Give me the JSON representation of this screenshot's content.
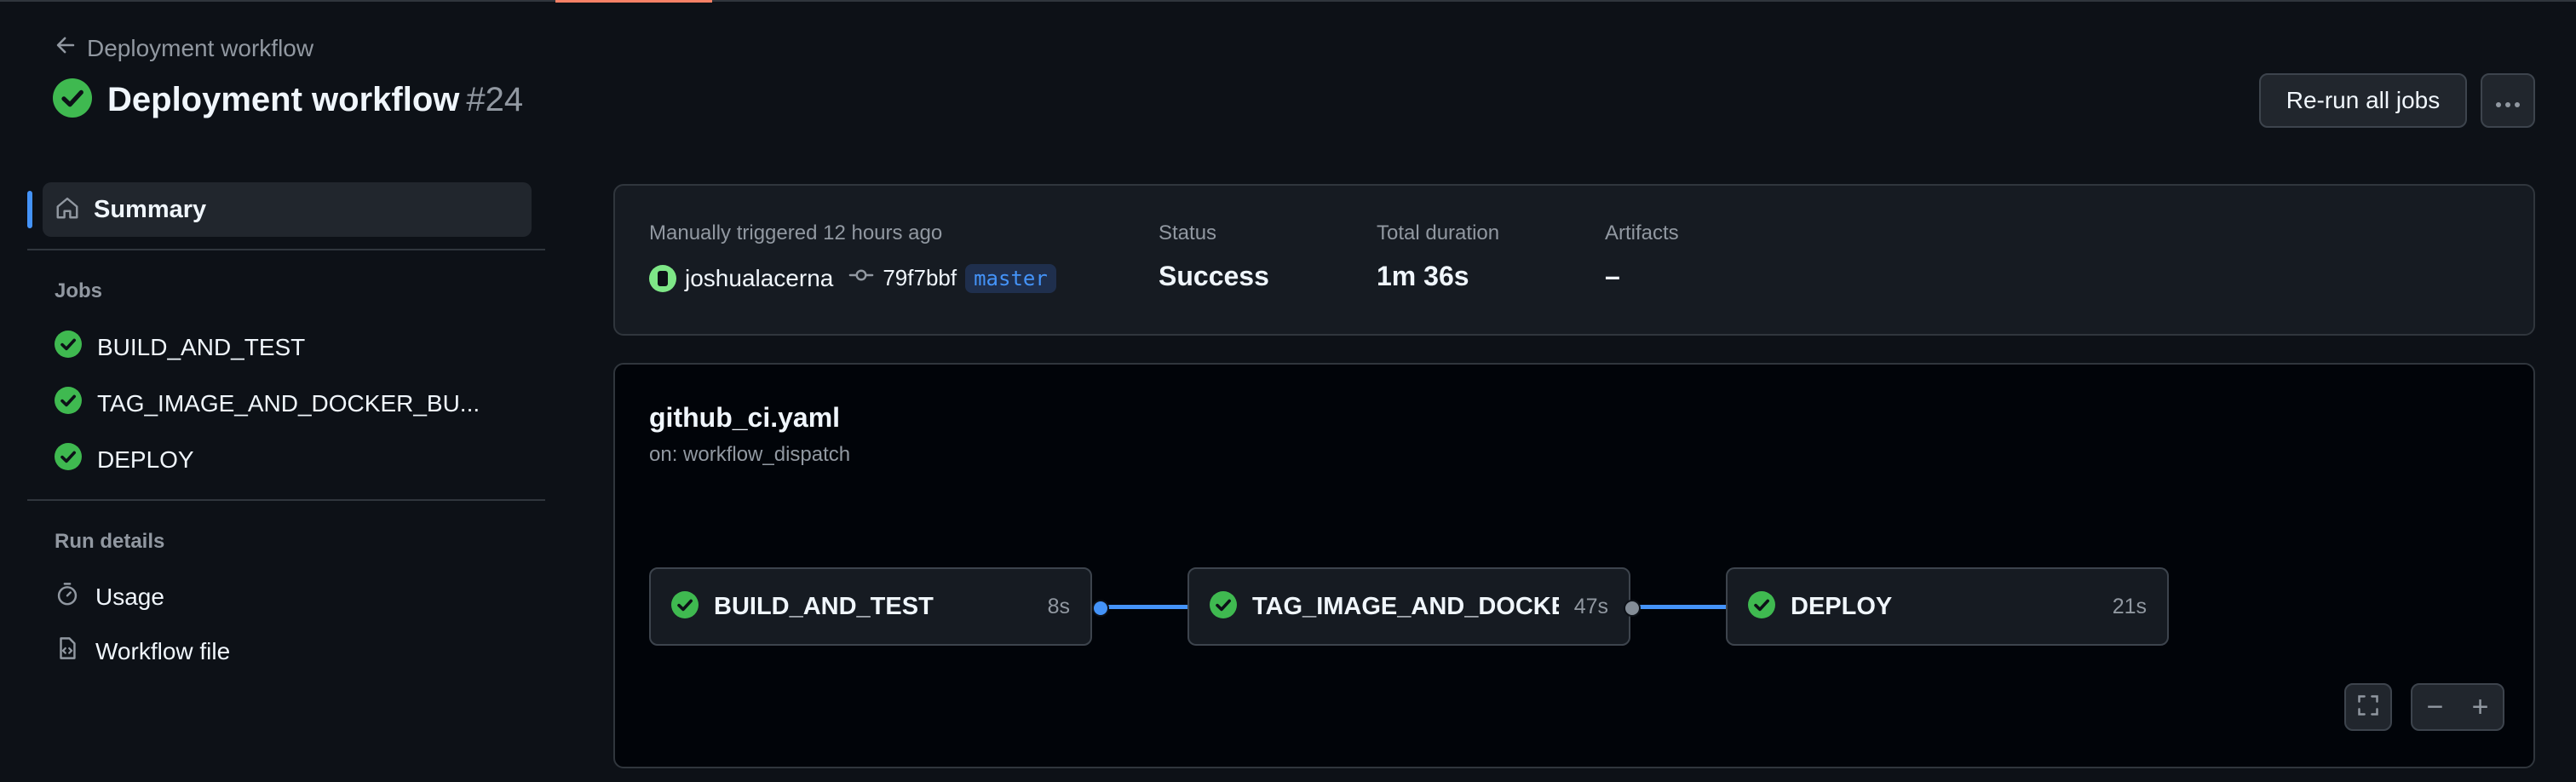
{
  "header": {
    "back_label": "Deployment workflow",
    "title": "Deployment workflow",
    "run_number": "#24",
    "rerun_label": "Re-run all jobs",
    "more_label": "···"
  },
  "sidebar": {
    "summary_label": "Summary",
    "jobs_heading": "Jobs",
    "jobs": [
      {
        "label": "BUILD_AND_TEST",
        "status": "success"
      },
      {
        "label": "TAG_IMAGE_AND_DOCKER_BU...",
        "status": "success"
      },
      {
        "label": "DEPLOY",
        "status": "success"
      }
    ],
    "run_details_heading": "Run details",
    "usage_label": "Usage",
    "workflow_file_label": "Workflow file"
  },
  "summary": {
    "trigger_text": "Manually triggered 12 hours ago",
    "actor": "joshualacerna",
    "commit": "79f7bbf",
    "branch": "master",
    "status_label": "Status",
    "status_value": "Success",
    "duration_label": "Total duration",
    "duration_value": "1m 36s",
    "artifacts_label": "Artifacts",
    "artifacts_value": "–"
  },
  "graph": {
    "file_name": "github_ci.yaml",
    "trigger": "on: workflow_dispatch",
    "jobs": [
      {
        "label": "BUILD_AND_TEST",
        "duration": "8s"
      },
      {
        "label": "TAG_IMAGE_AND_DOCKE...",
        "duration": "47s"
      },
      {
        "label": "DEPLOY",
        "duration": "21s"
      }
    ],
    "zoom_minus": "−",
    "zoom_plus": "+"
  },
  "colors": {
    "background": "#0d1117",
    "success": "#3fb950",
    "accent": "#4493f8",
    "tab_underline": "#f78166"
  }
}
